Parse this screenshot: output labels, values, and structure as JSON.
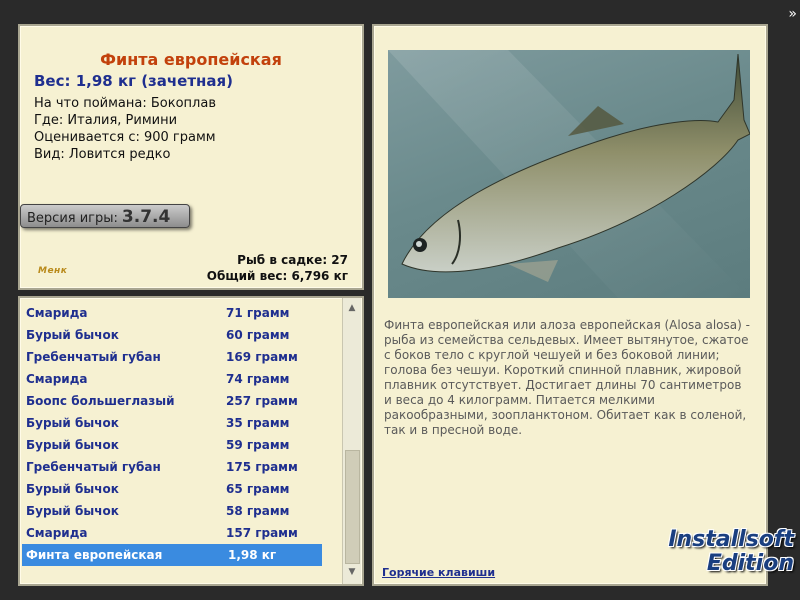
{
  "info": {
    "fish_name": "Финта европейская",
    "weight_text": "Вес: 1,98 кг (зачетная)",
    "caught_on": "На что поймана: Бокоплав",
    "location": "Где: Италия, Римини",
    "rated_from": "Оценивается с: 900 грамм",
    "rarity": "Вид: Ловится редко",
    "version_label": "Версия игры:",
    "version_number": "3.7.4",
    "logo_text": "Менк",
    "fish_in_cage": "Рыб в садке: 27",
    "total_weight": "Общий вес: 6,796 кг"
  },
  "catch_list": [
    {
      "name": "Смарида",
      "weight": "71 грамм"
    },
    {
      "name": "Бурый бычок",
      "weight": "60 грамм"
    },
    {
      "name": "Гребенчатый губан",
      "weight": "169 грамм"
    },
    {
      "name": "Смарида",
      "weight": "74 грамм"
    },
    {
      "name": "Боопс большеглазый",
      "weight": "257 грамм"
    },
    {
      "name": "Бурый бычок",
      "weight": "35 грамм"
    },
    {
      "name": "Бурый бычок",
      "weight": "59 грамм"
    },
    {
      "name": "Гребенчатый губан",
      "weight": "175 грамм"
    },
    {
      "name": "Бурый бычок",
      "weight": "65 грамм"
    },
    {
      "name": "Бурый бычок",
      "weight": "58 грамм"
    },
    {
      "name": "Смарида",
      "weight": "157 грамм"
    },
    {
      "name": "Финта европейская",
      "weight": "1,98 кг",
      "selected": true
    }
  ],
  "description": "Финта европейская или алоза европейская (Alosa alosa) - рыба из семейства сельдевых. Имеет вытянутое, сжатое с боков тело с круглой чешуей и без боковой линии; голова без чешуи. Короткий спинной плавник, жировой плавник отсутствует. Достигает длины 70 сантиметров и веса до 4 килограмм. Питается мелкими ракообразными, зоопланктоном. Обитает как в соленой, так и в пресной воде.",
  "hotkeys_link": "Горячие клавиши",
  "skip_icon": "»",
  "watermark": {
    "line1": "Installsoft",
    "line2": "Edition"
  },
  "colors": {
    "accent_name": "#c2410c",
    "list_text": "#1f2f8f",
    "selection": "#3a8be0",
    "panel_bg": "#f6f1d2"
  }
}
